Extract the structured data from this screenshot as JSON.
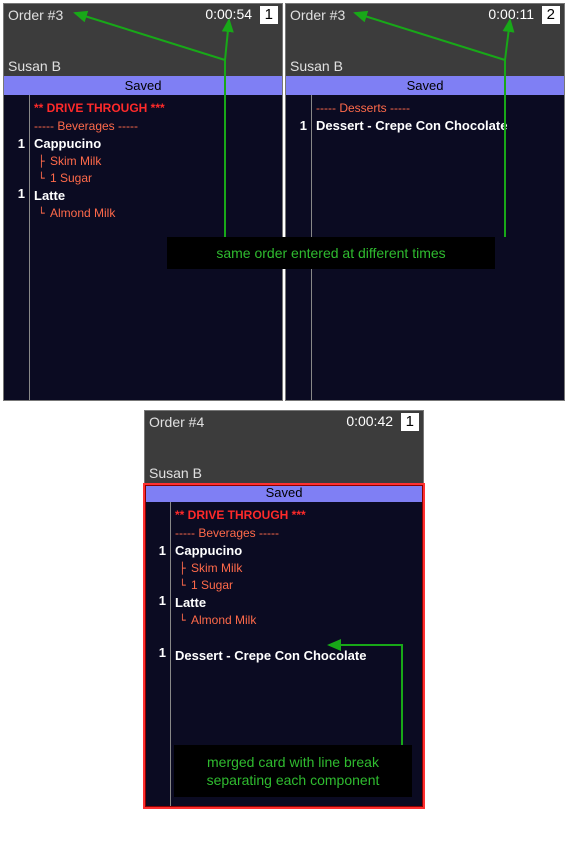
{
  "top_cards": [
    {
      "order_label": "Order #3",
      "timer": "0:00:54",
      "slot": "1",
      "server": "Susan B",
      "status": "Saved",
      "notice": "** DRIVE THROUGH ***",
      "category": "----- Beverages -----",
      "items": [
        {
          "qty": "1",
          "name": "Cappucino",
          "mods": [
            "Skim Milk",
            "1 Sugar"
          ]
        },
        {
          "qty": "1",
          "name": "Latte",
          "mods": [
            "Almond Milk"
          ]
        }
      ]
    },
    {
      "order_label": "Order #3",
      "timer": "0:00:11",
      "slot": "2",
      "server": "Susan B",
      "status": "Saved",
      "notice": "",
      "category": "----- Desserts -----",
      "items": [
        {
          "qty": "1",
          "name": "Dessert - Crepe Con Chocolate",
          "mods": []
        }
      ]
    }
  ],
  "annotation_top": "same order entered at different times",
  "merged_card": {
    "order_label": "Order #4",
    "timer": "0:00:42",
    "slot": "1",
    "server": "Susan B",
    "status": "Saved",
    "notice": "** DRIVE THROUGH ***",
    "category1": "----- Beverages -----",
    "group1_items": [
      {
        "qty": "1",
        "name": "Cappucino",
        "mods": [
          "Skim Milk",
          "1 Sugar"
        ]
      },
      {
        "qty": "1",
        "name": "Latte",
        "mods": [
          "Almond Milk"
        ]
      }
    ],
    "group2_items": [
      {
        "qty": "1",
        "name": "Dessert - Crepe Con Chocolate",
        "mods": []
      }
    ]
  },
  "annotation_bottom_line1": "merged card with line break",
  "annotation_bottom_line2": "separating each component"
}
